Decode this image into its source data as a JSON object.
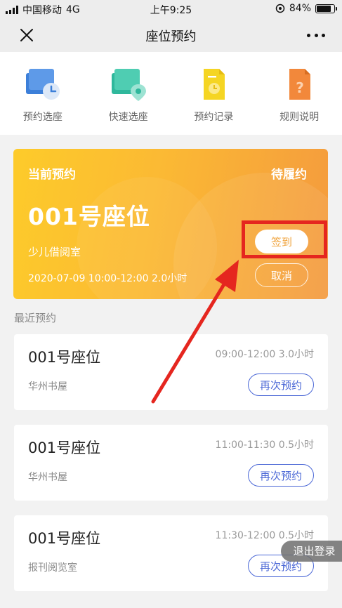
{
  "status_bar": {
    "carrier": "中国移动",
    "network": "4G",
    "time": "上午9:25",
    "battery": "84%",
    "battery_level": 0.84
  },
  "nav": {
    "title": "座位预约"
  },
  "menu": [
    {
      "label": "预约选座",
      "icon": "seat-booking-icon"
    },
    {
      "label": "快速选座",
      "icon": "quick-seat-icon"
    },
    {
      "label": "预约记录",
      "icon": "record-icon"
    },
    {
      "label": "规则说明",
      "icon": "rules-icon"
    }
  ],
  "current": {
    "label": "当前预约",
    "status": "待履约",
    "seat": "001号座位",
    "room": "少儿借阅室",
    "datetime": "2020-07-09   10:00-12:00   2.0小时",
    "checkin_label": "签到",
    "cancel_label": "取消"
  },
  "recent": {
    "title": "最近预约",
    "items": [
      {
        "seat": "001号座位",
        "time": "09:00-12:00   3.0小时",
        "room": "华州书屋",
        "action": "再次预约"
      },
      {
        "seat": "001号座位",
        "time": "11:00-11:30   0.5小时",
        "room": "华州书屋",
        "action": "再次预约"
      },
      {
        "seat": "001号座位",
        "time": "11:30-12:00   0.5小时",
        "room": "报刊阅览室",
        "action": "再次预约"
      }
    ]
  },
  "logout_label": "退出登录",
  "colors": {
    "accent": "#f5a623",
    "link": "#4a67d6",
    "annotation": "#e5261f"
  }
}
